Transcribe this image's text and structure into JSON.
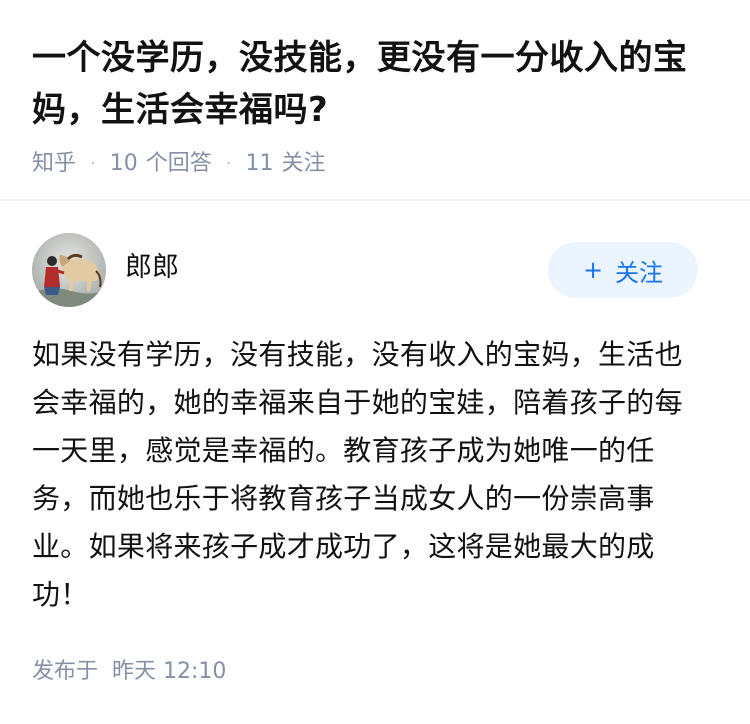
{
  "question": {
    "title": "一个没学历，没技能，更没有一分收入的宝妈，生活会幸福吗?",
    "source": "知乎",
    "answer_count": "10",
    "answer_label": "个回答",
    "follower_count": "11",
    "follower_label": "关注"
  },
  "author": {
    "name": "郎郎",
    "avatar_icon": "avatar-horse-painting-icon"
  },
  "follow_button": {
    "plus": "+",
    "label": "关注"
  },
  "answer": {
    "text": "如果没有学历，没有技能，没有收入的宝妈，生活也会幸福的，她的幸福来自于她的宝娃，陪着孩子的每一天里，感觉是幸福的。教育孩子成为她唯一的任务，而她也乐于将教育孩子当成女人的一份崇高事业。如果将来孩子成才成功了，这将是她最大的成功！",
    "published_label": "发布于",
    "published_time": "昨天 12:10"
  },
  "colors": {
    "title": "#121212",
    "meta": "#8590a6",
    "accent": "#1772f6",
    "button_bg": "#ebf5ff",
    "divider": "#f0f2f7"
  }
}
